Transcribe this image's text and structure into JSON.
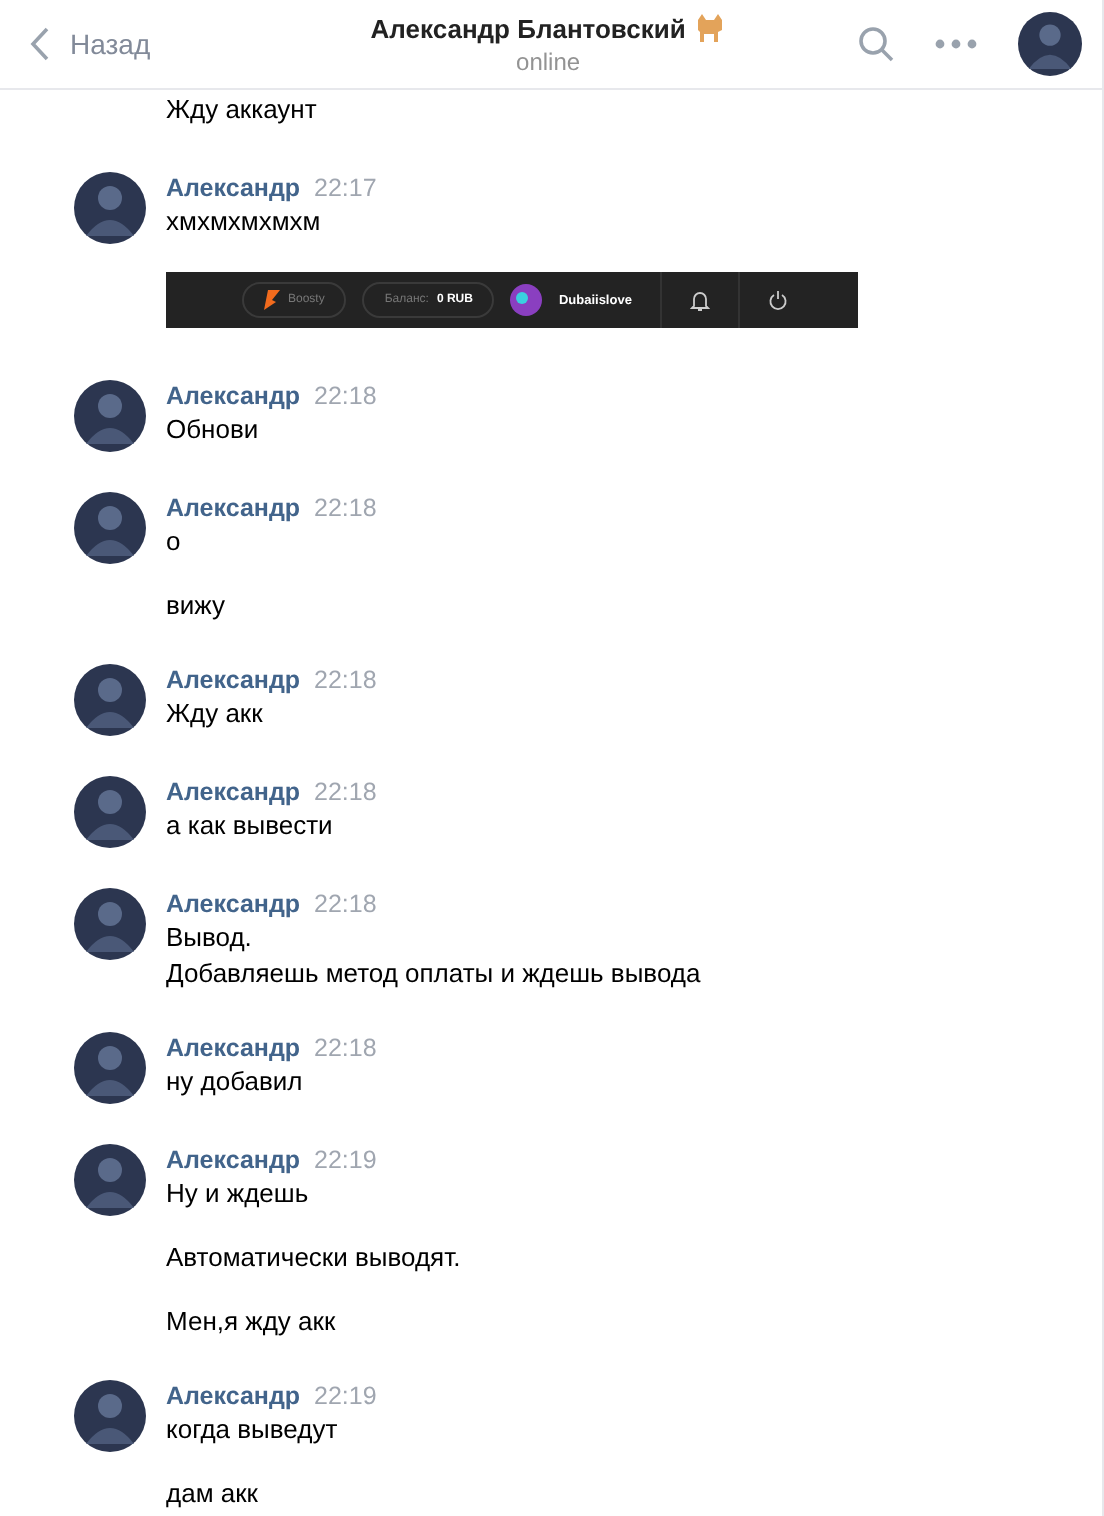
{
  "header": {
    "back_label": "Назад",
    "title": "Александр Блантовский",
    "status": "online"
  },
  "partial_message": "Жду аккаунт",
  "groups": [
    {
      "name": "Александр",
      "time": "22:17",
      "messages": [
        {
          "kind": "text",
          "text": "хмхмхмхмхм"
        },
        {
          "kind": "screenshot",
          "brand": "Boosty",
          "balance": "Баланс: **0 RUB**",
          "user": "Dubaiislove"
        }
      ]
    },
    {
      "name": "Александр",
      "time": "22:18",
      "messages": [
        {
          "kind": "text",
          "text": "Обнови"
        }
      ]
    },
    {
      "name": "Александр",
      "time": "22:18",
      "messages": [
        {
          "kind": "text",
          "text": "о"
        },
        {
          "kind": "text",
          "text": "вижу"
        }
      ]
    },
    {
      "name": "Александр",
      "time": "22:18",
      "messages": [
        {
          "kind": "text",
          "text": "Жду акк"
        }
      ]
    },
    {
      "name": "Александр",
      "time": "22:18",
      "messages": [
        {
          "kind": "text",
          "text": "а как вывести"
        }
      ]
    },
    {
      "name": "Александр",
      "time": "22:18",
      "messages": [
        {
          "kind": "text",
          "text": "Вывод.\nДобавляешь метод оплаты и ждешь вывода"
        }
      ]
    },
    {
      "name": "Александр",
      "time": "22:18",
      "messages": [
        {
          "kind": "text",
          "text": "ну добавил"
        }
      ]
    },
    {
      "name": "Александр",
      "time": "22:19",
      "messages": [
        {
          "kind": "text",
          "text": "Ну и ждешь"
        },
        {
          "kind": "text",
          "text": "Автоматически выводят."
        },
        {
          "kind": "text",
          "text": "Мен,я жду акк"
        }
      ]
    },
    {
      "name": "Александр",
      "time": "22:19",
      "messages": [
        {
          "kind": "text",
          "text": "когда выведут"
        },
        {
          "kind": "text",
          "text": "дам акк"
        }
      ]
    }
  ]
}
